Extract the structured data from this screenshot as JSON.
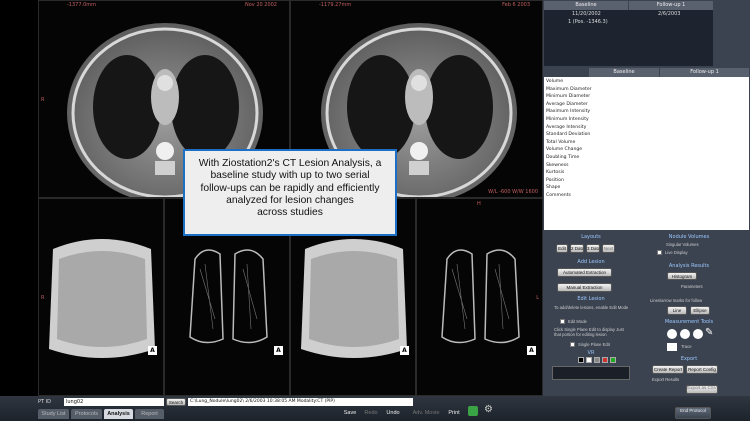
{
  "viewports": {
    "top_left": {
      "header_left": "-1377.0mm",
      "header_right": "Nov 20 2002",
      "side_letter": "R"
    },
    "top_right": {
      "header_left": "-1179.27mm",
      "header_right": "Feb 6 2003",
      "footer": "W/L -600 W/W 1600"
    },
    "bottom": {
      "corner_mark": "A",
      "side_letter": "R",
      "side_letter_right": "L",
      "top_letter": "H"
    }
  },
  "overlay": {
    "lines": [
      "With Ziostation2's CT Lesion Analysis, a",
      "baseline study with up to two serial",
      "follow-ups can be rapidly and efficiently",
      "analyzed for lesion changes",
      "across studies"
    ]
  },
  "series_table": {
    "baseline_header": "Baseline",
    "followup_header": "Follow-up 1",
    "baseline_date": "11/20/2002",
    "followup_date": "2/6/2003",
    "row1": "1 (Pos. -1346.3)"
  },
  "metrics_table": {
    "baseline_header": "Baseline",
    "followup_header": "Follow-up 1",
    "rows": [
      "Volume",
      "Maximum Diameter",
      "Minimum Diameter",
      "Average Diameter",
      "Maximum Intensity",
      "Minimum Intensity",
      "Average Intensity",
      "Standard Deviation",
      "Total Volume",
      "Volume Change",
      "Doubling Time",
      "Skewness",
      "Kurtosis",
      "Position",
      "Shape",
      "Comments"
    ]
  },
  "controls": {
    "layouts_title": "Layouts",
    "layout_buttons": [
      "Edit",
      "2 Data",
      "3 Data",
      "Next"
    ],
    "add_lesion_title": "Add Lesion",
    "automated_extraction": "Automated Extraction",
    "manual_extraction": "Manual Extraction",
    "edit_lesion_title": "Edit Lesion",
    "edit_lesion_note": "To add/delete lesions, enable Edit Mode",
    "edit_mode": "Edit Mode",
    "edit_note2": "Click Single Plane Edit to display Just that portion for editing lesion",
    "single_plane_edit": "Single Plane Edit",
    "vr_title": "VR",
    "nodule_title": "Nodule Volumes",
    "nodule_label1": "Singular Volumes",
    "live_display": "Live Display",
    "analysis_title": "Analysis Results",
    "histogram": "Histogram",
    "parameters": "Parameters",
    "lines_note": "Lines/arrow marks for follow",
    "line_btn": "Line",
    "ellipse_btn": "Ellipse",
    "measurement_title": "Measurement Tools",
    "trace_label": "Trace",
    "export_title": "Export",
    "create_report": "Create Report",
    "report_config": "Report Config",
    "export_results": "Export Results",
    "export_as": "Export as CSV"
  },
  "bottom_bar": {
    "pt_id_label": "PT ID",
    "pt_id_value": "lung02",
    "search_label": "Search",
    "path": "C:\\Lung_Nodule\\lung02\\ 2/6/2003 10:38:05 AM Modality:CT (PIP)",
    "tabs": [
      "Study List",
      "Protocols",
      "Analysis",
      "Report"
    ],
    "active_tab": "Analysis",
    "save": "Save",
    "redo": "Redo",
    "undo": "Undo",
    "adv_movie": "Adv. Movie",
    "print": "Print",
    "end_protocol": "End Protocol"
  }
}
